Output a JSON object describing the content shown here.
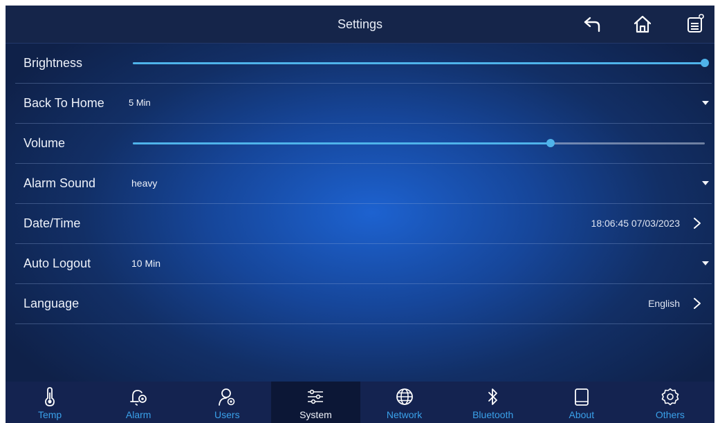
{
  "header": {
    "title": "Settings",
    "icons": [
      "back-arrow-icon",
      "home-icon",
      "manual-icon"
    ]
  },
  "settings": {
    "brightness": {
      "label": "Brightness",
      "level_percent": 100
    },
    "back_to_home": {
      "label": "Back To Home",
      "value": "5 Min"
    },
    "volume": {
      "label": "Volume",
      "level_percent": 73
    },
    "alarm_sound": {
      "label": "Alarm Sound",
      "value": "heavy"
    },
    "date_time": {
      "label": "Date/Time",
      "value": "18:06:45 07/03/2023"
    },
    "auto_logout": {
      "label": "Auto Logout",
      "value": "10 Min"
    },
    "language": {
      "label": "Language",
      "value": "English"
    }
  },
  "nav": {
    "active": "System",
    "items": [
      {
        "label": "Temp",
        "icon": "thermometer-icon"
      },
      {
        "label": "Alarm",
        "icon": "alarm-bell-icon"
      },
      {
        "label": "Users",
        "icon": "user-settings-icon"
      },
      {
        "label": "System",
        "icon": "sliders-icon"
      },
      {
        "label": "Network",
        "icon": "globe-icon"
      },
      {
        "label": "Bluetooth",
        "icon": "bluetooth-icon"
      },
      {
        "label": "About",
        "icon": "tablet-icon"
      },
      {
        "label": "Others",
        "icon": "gear-icon"
      }
    ]
  },
  "colors": {
    "accent": "#4fb3ea",
    "nav_label": "#3aa1ea",
    "header_bg": "#15254a",
    "nav_bg": "#142350"
  }
}
